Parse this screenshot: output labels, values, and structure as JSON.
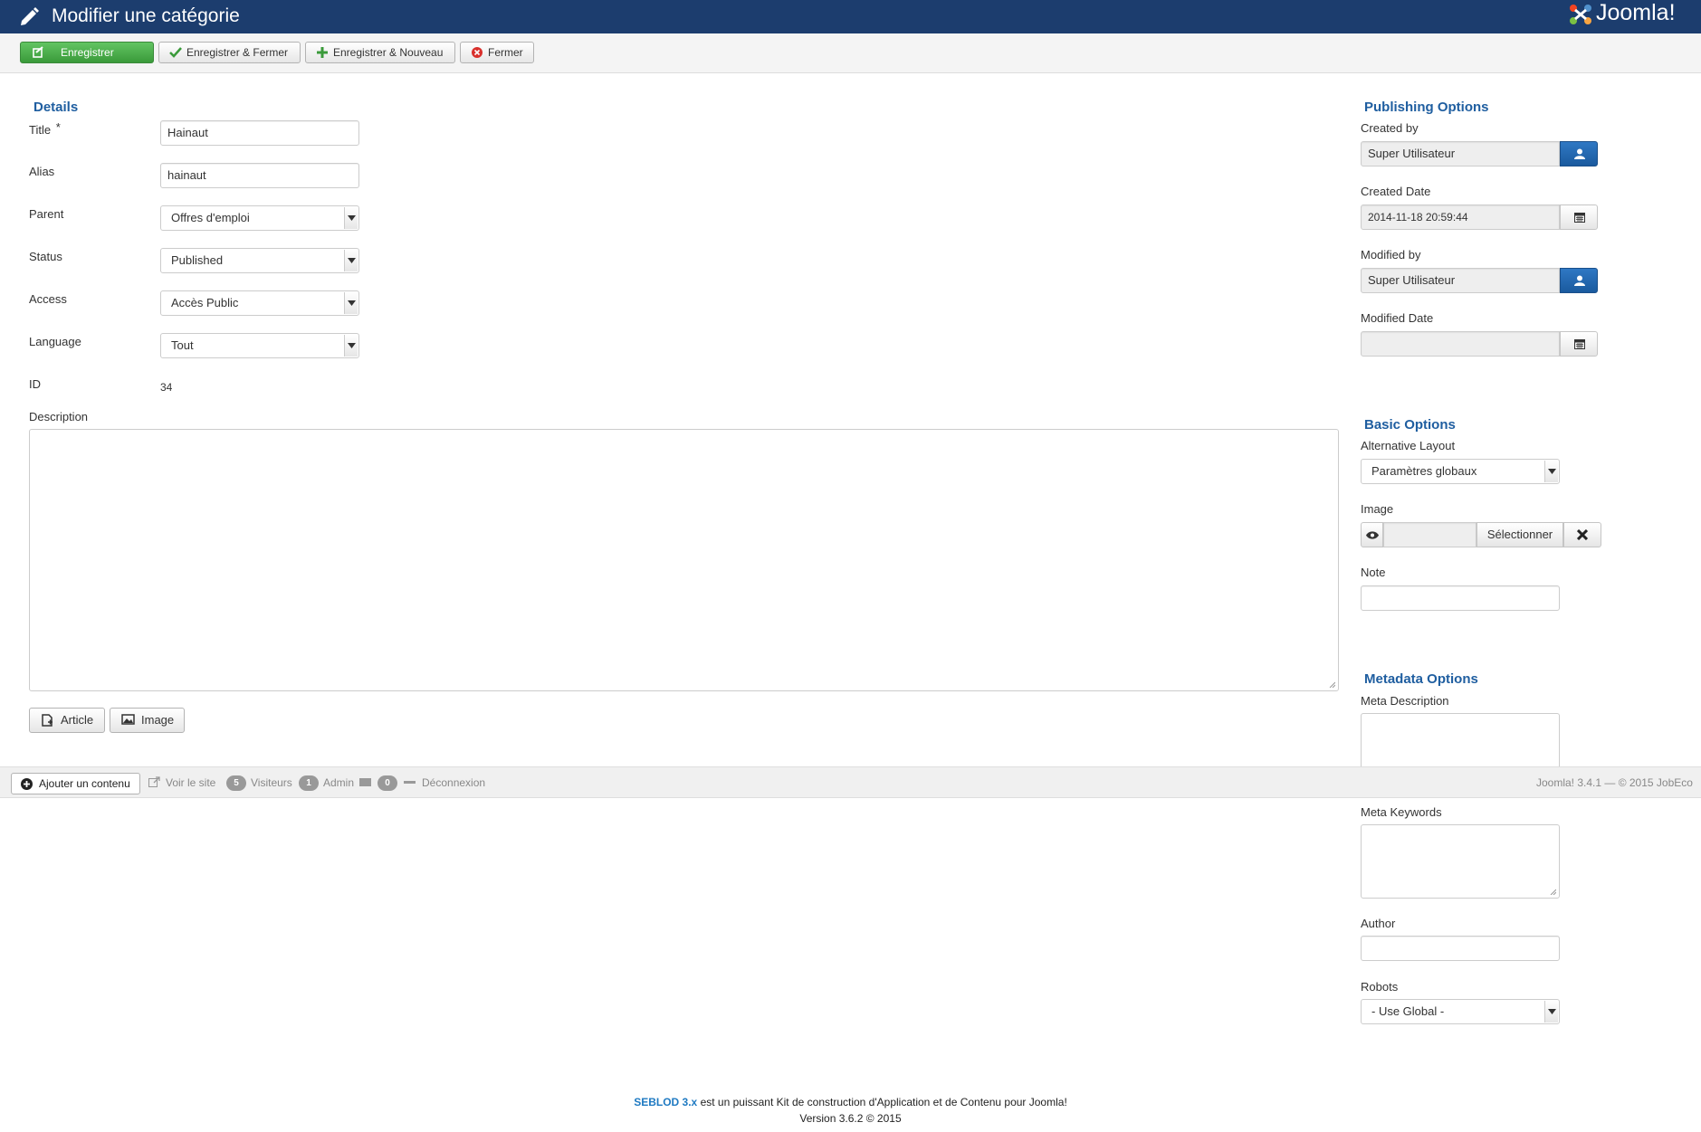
{
  "header": {
    "title": "Modifier une catégorie",
    "logo_text": "Joomla!"
  },
  "toolbar": {
    "save_label": "Enregistrer",
    "save_close_label": "Enregistrer & Fermer",
    "save_new_label": "Enregistrer & Nouveau",
    "close_label": "Fermer"
  },
  "details": {
    "heading": "Details",
    "title_label": "Title",
    "required_mark": "*",
    "title_value": "Hainaut",
    "alias_label": "Alias",
    "alias_value": "hainaut",
    "parent_label": "Parent",
    "parent_value": "Offres d'emploi",
    "status_label": "Status",
    "status_value": "Published",
    "access_label": "Access",
    "access_value": "Accès Public",
    "language_label": "Language",
    "language_value": "Tout",
    "id_label": "ID",
    "id_value": "34",
    "description_label": "Description",
    "article_button": "Article",
    "image_button": "Image"
  },
  "publishing": {
    "heading": "Publishing Options",
    "created_by_label": "Created by",
    "created_by_value": "Super Utilisateur",
    "created_date_label": "Created Date",
    "created_date_value": "2014-11-18 20:59:44",
    "modified_by_label": "Modified by",
    "modified_by_value": "Super Utilisateur",
    "modified_date_label": "Modified Date",
    "modified_date_value": ""
  },
  "basic": {
    "heading": "Basic Options",
    "layout_label": "Alternative Layout",
    "layout_value": "Paramètres globaux",
    "image_label": "Image",
    "select_button": "Sélectionner",
    "note_label": "Note",
    "note_value": ""
  },
  "metadata": {
    "heading": "Metadata Options",
    "meta_description_label": "Meta Description",
    "meta_keywords_label": "Meta Keywords",
    "author_label": "Author",
    "robots_label": "Robots",
    "robots_value": "- Use Global -"
  },
  "statusbar": {
    "add_content": "Ajouter un contenu",
    "view_site": "Voir le site",
    "visitors_count": "5",
    "visitors_label": "Visiteurs",
    "admin_count": "1",
    "admin_label": "Admin",
    "messages_count": "0",
    "logout_label": "Déconnexion",
    "version_text": "Joomla! 3.4.1 — © 2015 JobEco"
  },
  "footer": {
    "seblod_link": "SEBLOD 3.x",
    "tagline": " est un puissant Kit de construction d'Application et de Contenu pour Joomla!",
    "version": "Version 3.6.2 © 2015"
  }
}
